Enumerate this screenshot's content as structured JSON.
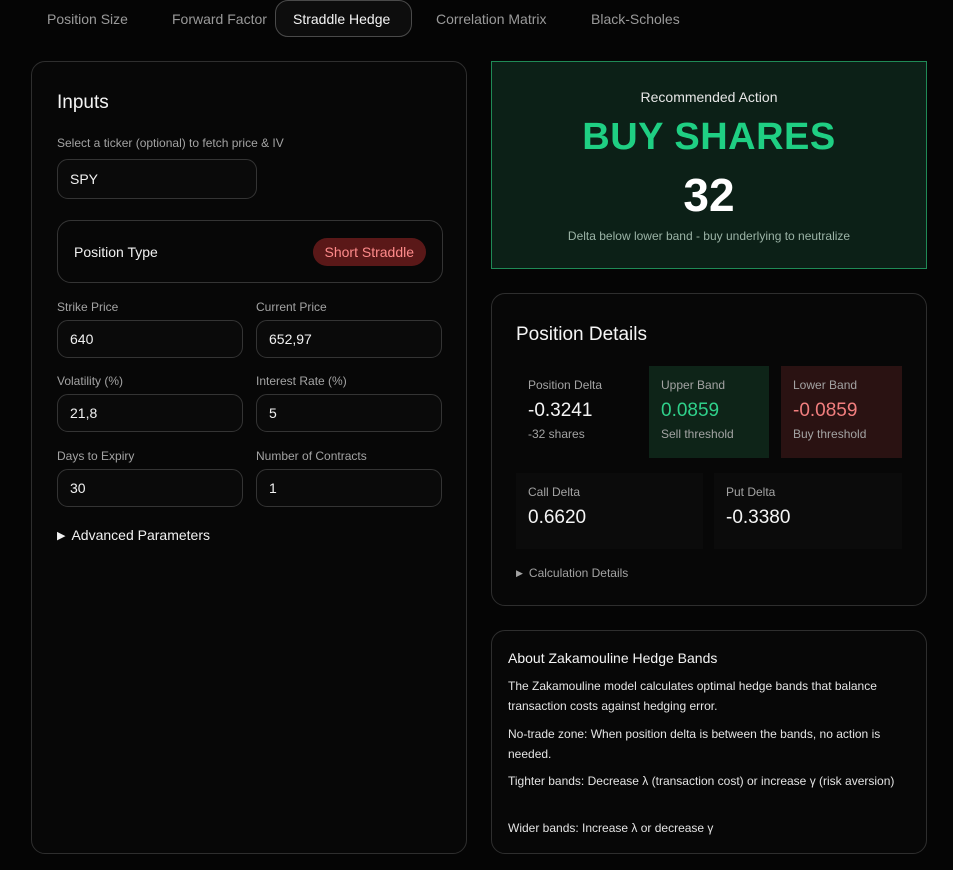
{
  "tabs": [
    {
      "label": "Position Size",
      "active": false
    },
    {
      "label": "Forward Factor",
      "active": false
    },
    {
      "label": "Straddle Hedge",
      "active": true
    },
    {
      "label": "Correlation Matrix",
      "active": false
    },
    {
      "label": "Black-Scholes",
      "active": false
    }
  ],
  "inputs": {
    "title": "Inputs",
    "ticker_label": "Select a ticker (optional) to fetch price & IV",
    "ticker_value": "SPY",
    "position_type_label": "Position Type",
    "position_type_value": "Short Straddle",
    "strike_label": "Strike Price",
    "strike_value": "640",
    "current_price_label": "Current Price",
    "current_price_value": "652,97",
    "volatility_label": "Volatility (%)",
    "volatility_value": "21,8",
    "interest_label": "Interest Rate (%)",
    "interest_value": "5",
    "days_label": "Days to Expiry",
    "days_value": "30",
    "contracts_label": "Number of Contracts",
    "contracts_value": "1",
    "advanced_label": "Advanced Parameters"
  },
  "recommendation": {
    "label": "Recommended Action",
    "action": "BUY SHARES",
    "quantity": "32",
    "note": "Delta below lower band - buy underlying to neutralize"
  },
  "details": {
    "title": "Position Details",
    "position_delta": {
      "label": "Position Delta",
      "value": "-0.3241",
      "sub": "-32 shares"
    },
    "upper_band": {
      "label": "Upper Band",
      "value": "0.0859",
      "sub": "Sell threshold"
    },
    "lower_band": {
      "label": "Lower Band",
      "value": "-0.0859",
      "sub": "Buy threshold"
    },
    "call_delta": {
      "label": "Call Delta",
      "value": "0.6620"
    },
    "put_delta": {
      "label": "Put Delta",
      "value": "-0.3380"
    },
    "calc_label": "Calculation Details"
  },
  "about": {
    "title": "About Zakamouline Hedge Bands",
    "p1": "The Zakamouline model calculates optimal hedge bands that balance transaction costs against hedging error.",
    "p2": "No-trade zone: When position delta is between the bands, no action is needed.",
    "p3": "Tighter bands: Decrease λ (transaction cost) or increase γ (risk aversion)",
    "p4": "Wider bands: Increase λ or decrease γ"
  },
  "colors": {
    "accent_green": "#1fcf83",
    "danger_red": "#f17e7e"
  }
}
